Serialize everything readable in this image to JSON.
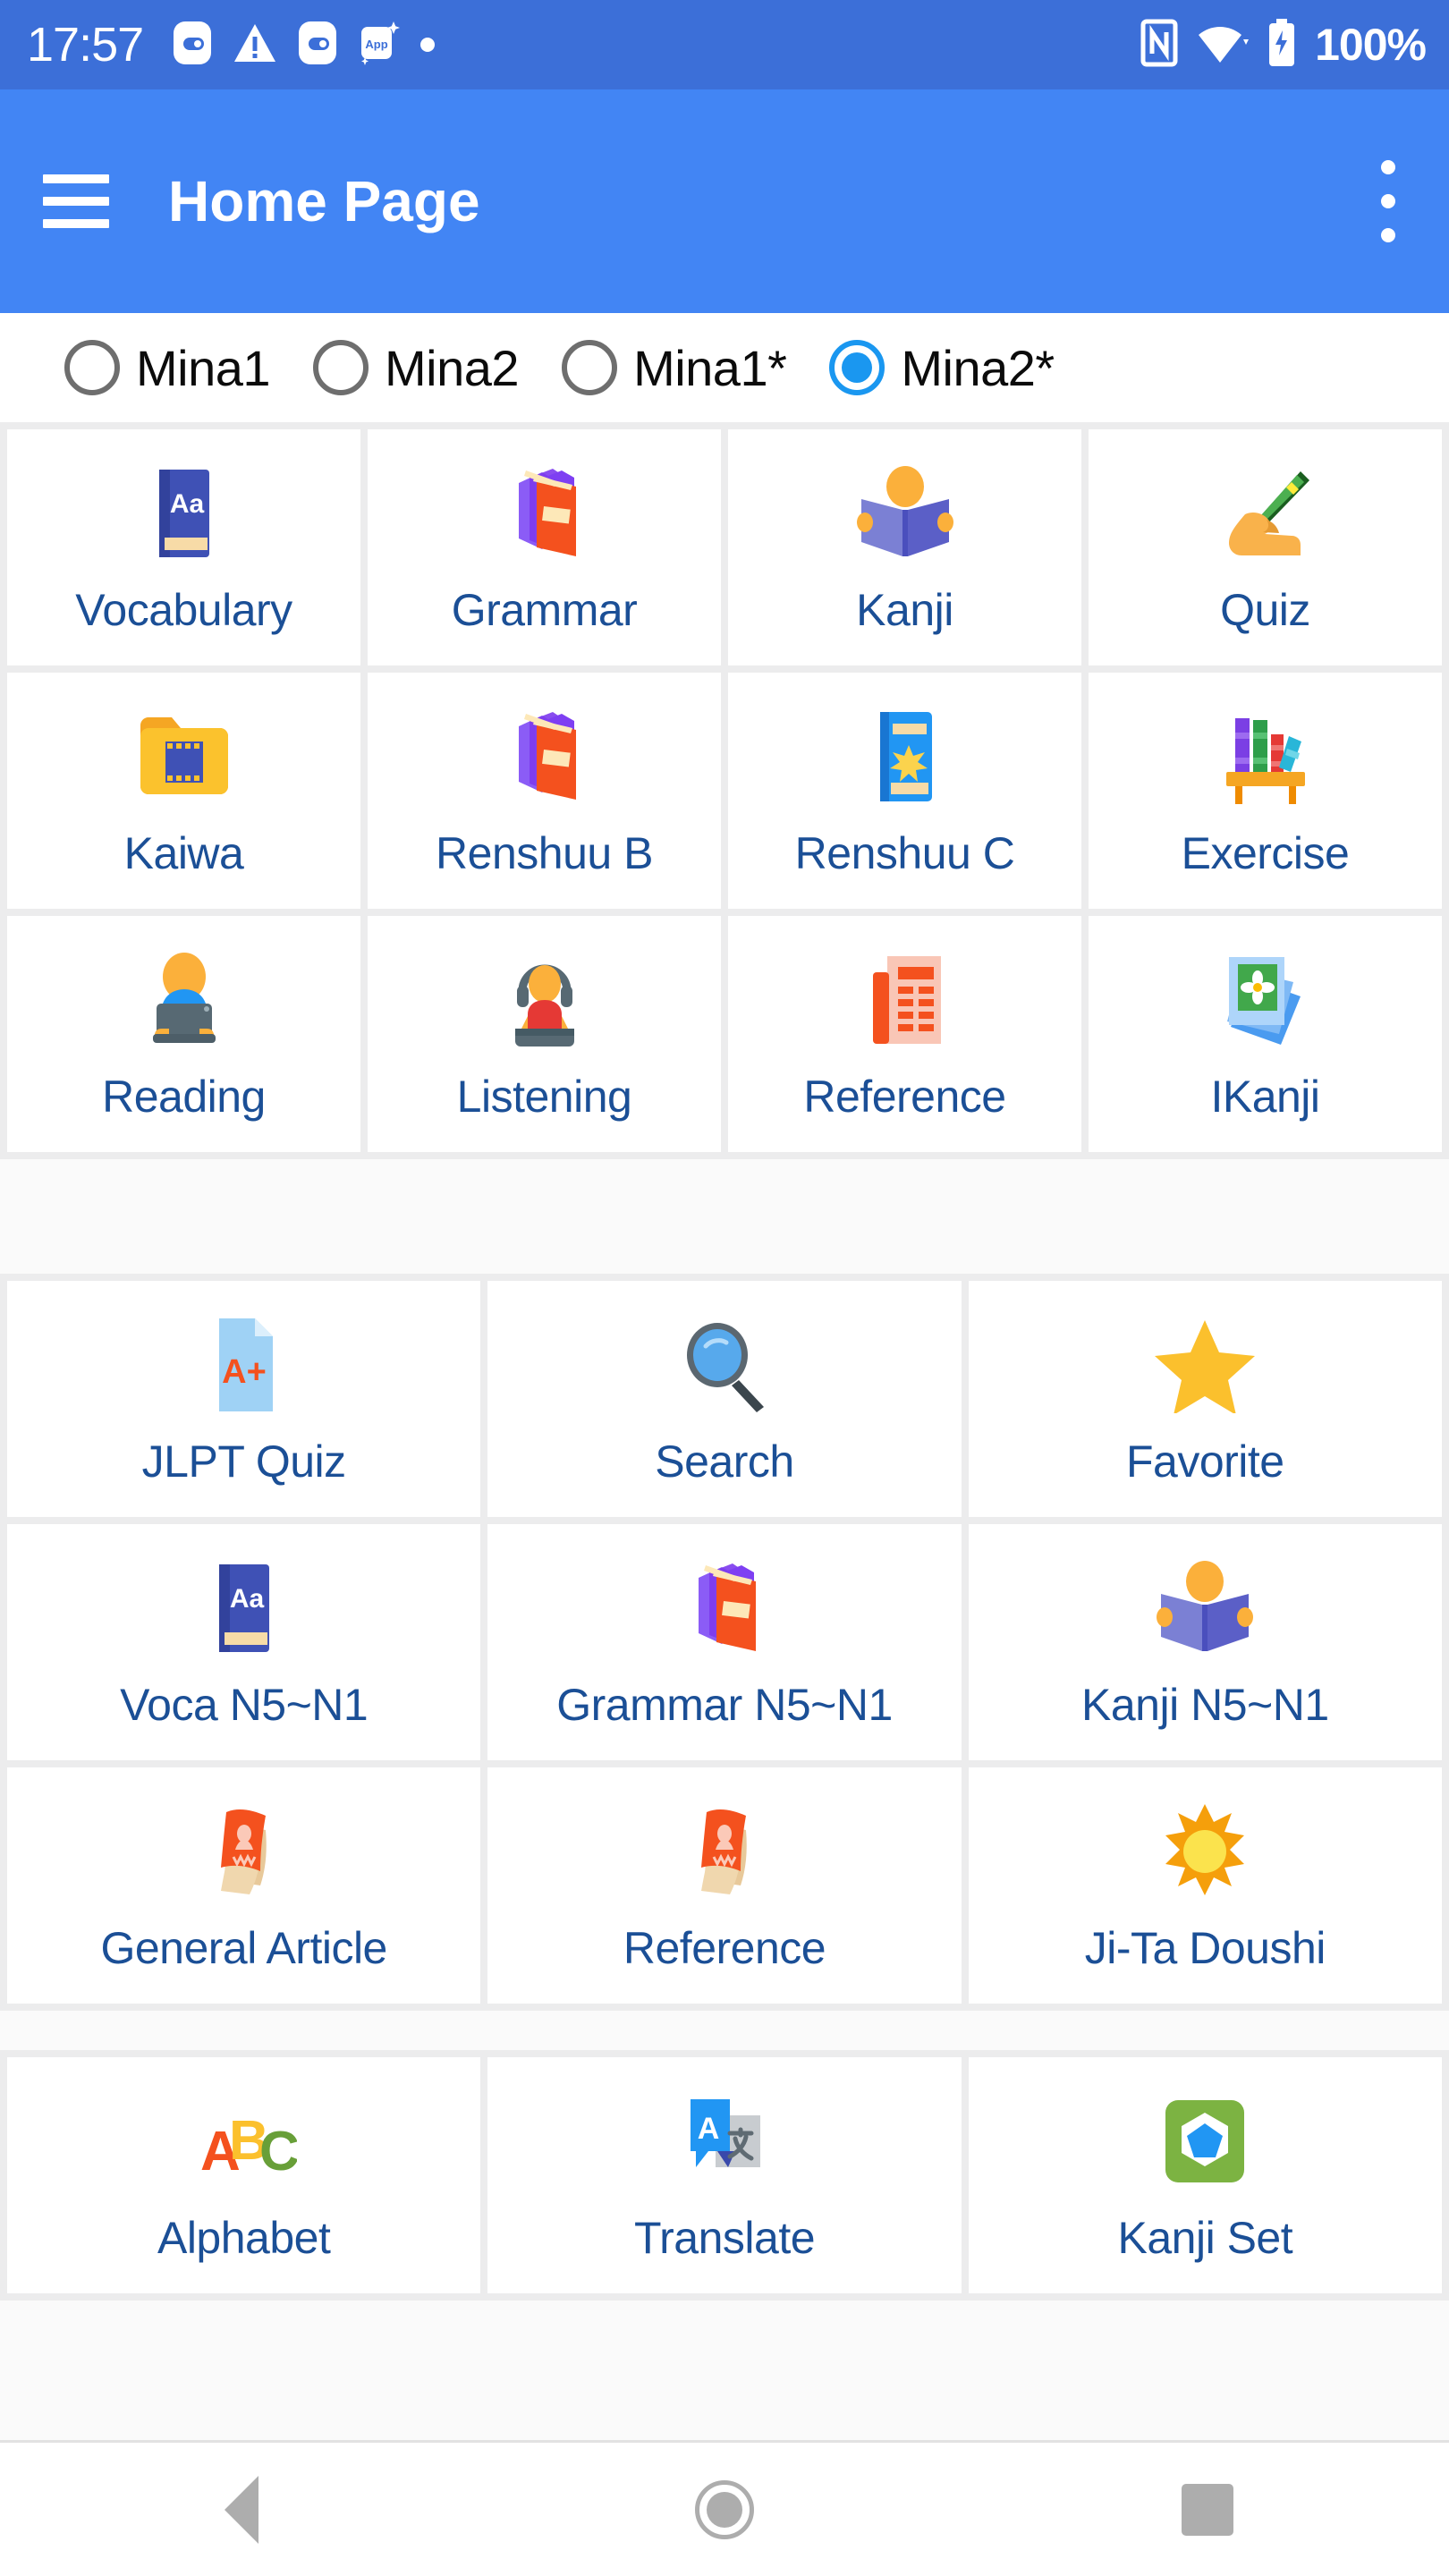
{
  "status_bar": {
    "clock": "17:57",
    "battery_percent": "100%",
    "left_icons": [
      "cloud-app-icon",
      "warning-triangle-icon",
      "cloud-app-icon",
      "app-sparkle-icon",
      "dot-icon"
    ],
    "right_icons": [
      "nfc-icon",
      "wifi-icon",
      "battery-charging-icon"
    ],
    "background_color": "#3c6fd8"
  },
  "app_bar": {
    "menu_icon": "hamburger-menu-icon",
    "title": "Home Page",
    "overflow_icon": "more-vertical-icon",
    "background_color": "#4285f4"
  },
  "book_selector": {
    "options": [
      {
        "label": "Mina1",
        "checked": false
      },
      {
        "label": "Mina2",
        "checked": false
      },
      {
        "label": "Mina1*",
        "checked": false
      },
      {
        "label": "Mina2*",
        "checked": true
      }
    ],
    "checked_color": "#1a97f0",
    "unchecked_color": "#6e6e6e"
  },
  "label_color": "#1b4f96",
  "section_main": {
    "columns": 4,
    "tiles": [
      {
        "label": "Vocabulary",
        "icon": "blue-dictionary-book-icon"
      },
      {
        "label": "Grammar",
        "icon": "two-books-icon"
      },
      {
        "label": "Kanji",
        "icon": "person-reading-book-icon"
      },
      {
        "label": "Quiz",
        "icon": "hand-writing-pen-icon"
      },
      {
        "label": "Kaiwa",
        "icon": "film-folder-icon"
      },
      {
        "label": "Renshuu B",
        "icon": "two-books-icon"
      },
      {
        "label": "Renshuu C",
        "icon": "blue-star-book-icon"
      },
      {
        "label": "Exercise",
        "icon": "bookshelf-icon"
      },
      {
        "label": "Reading",
        "icon": "person-laptop-icon"
      },
      {
        "label": "Listening",
        "icon": "person-headphones-icon"
      },
      {
        "label": "Reference",
        "icon": "orange-document-icon"
      },
      {
        "label": "IKanji",
        "icon": "photo-stack-icon"
      }
    ]
  },
  "section_tools": {
    "columns": 3,
    "tiles": [
      {
        "label": "JLPT Quiz",
        "icon": "grade-a-plus-page-icon"
      },
      {
        "label": "Search",
        "icon": "magnifying-glass-icon"
      },
      {
        "label": "Favorite",
        "icon": "yellow-star-icon"
      },
      {
        "label": "Voca N5~N1",
        "icon": "blue-dictionary-book-icon"
      },
      {
        "label": "Grammar N5~N1",
        "icon": "two-books-icon"
      },
      {
        "label": "Kanji N5~N1",
        "icon": "person-reading-book-icon"
      },
      {
        "label": "General Article",
        "icon": "red-article-book-icon"
      },
      {
        "label": "Reference",
        "icon": "red-article-book-icon"
      },
      {
        "label": "Ji-Ta Doushi",
        "icon": "sun-icon"
      }
    ]
  },
  "section_extras": {
    "columns": 3,
    "tiles": [
      {
        "label": "Alphabet",
        "icon": "abc-letters-icon"
      },
      {
        "label": "Translate",
        "icon": "translate-icon"
      },
      {
        "label": "Kanji Set",
        "icon": "green-hexagon-pentagon-icon"
      }
    ]
  },
  "nav_bar": {
    "back": "back-triangle-icon",
    "home": "home-circle-icon",
    "recents": "recents-square-icon"
  }
}
